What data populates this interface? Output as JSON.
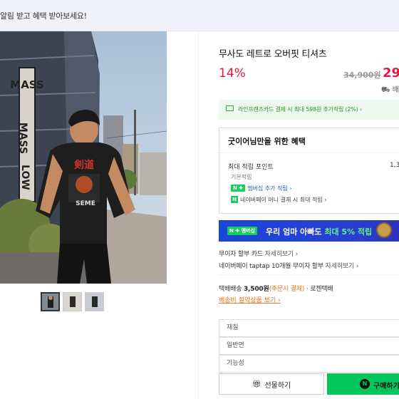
{
  "banner": {
    "text": "알림 받고 혜택 받아보세요!"
  },
  "product": {
    "title": "무사도 레트로 오버핏 티셔츠",
    "discount": "14%",
    "original_price": "34,900원",
    "sale_price": "29,",
    "shipping_icon_label": "배송"
  },
  "card_promo": {
    "text": "라인프렌즈카드 결제 시 최대 598원 추가적립 (2%) ›"
  },
  "benefit": {
    "heading": "굿이어님만을 위한 혜택",
    "points_label": "최대 적립 포인트",
    "points_value": "1,3",
    "basic_label": "기본적립",
    "membership_badge": "N ✚",
    "membership_link": "멤버십 추가 적립 ›",
    "money_badge": "N",
    "money_link": "네이버페이 머니 결제 시 최대 적립 ›"
  },
  "ad": {
    "badge": "N ✚ 멤버십",
    "text_main": "우리 엄마 아빠도 ",
    "text_highlight": "최대 5% 적립"
  },
  "installment": {
    "label": "무이자 할부 카드",
    "link": "자세히보기 ›",
    "taptap": "네이버페이 taptap 10개월 무이자 할부",
    "taptap_link": "자세히보기 ›"
  },
  "shipping": {
    "label": "택배배송",
    "fee": "3,500원",
    "fee_note": "(주문시 결제)",
    "carrier": "· 로젠택배",
    "saving_link": "배송비 절약상품 보기 ›"
  },
  "options": [
    "재질",
    "일반면",
    "기능성"
  ],
  "buttons": {
    "gift": "선물하기",
    "buy": "구매하기"
  },
  "colors": {
    "accent_red": "#e8173f",
    "naver_green": "#03c75a",
    "ad_blue": "#1a46d8"
  },
  "photo": {
    "sign_text_1": "MASS",
    "sign_text_2": "LOW",
    "shirt_text": "剣道",
    "shirt_sub": "SEME"
  }
}
